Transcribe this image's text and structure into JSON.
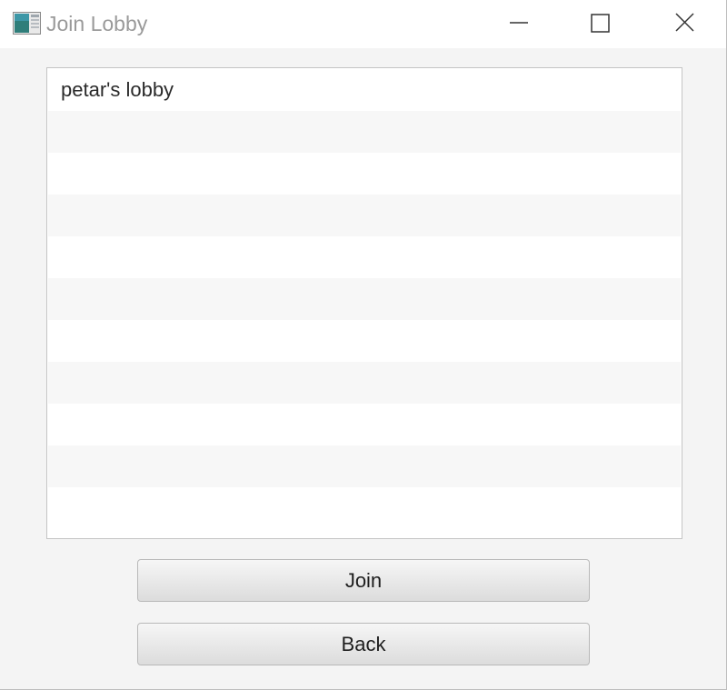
{
  "window": {
    "title": "Join Lobby",
    "controls": {
      "minimize_icon": "minimize-icon",
      "maximize_icon": "maximize-icon",
      "close_icon": "close-icon"
    }
  },
  "lobby_list": {
    "items": [
      "petar's lobby",
      "",
      "",
      "",
      "",
      "",
      "",
      "",
      "",
      "",
      ""
    ]
  },
  "actions": {
    "join_label": "Join",
    "back_label": "Back"
  },
  "colors": {
    "title_text": "#9a9a9a",
    "window_bg": "#f4f4f4",
    "alt_row_bg": "#f7f7f7",
    "button_border": "#b9b9b9"
  }
}
